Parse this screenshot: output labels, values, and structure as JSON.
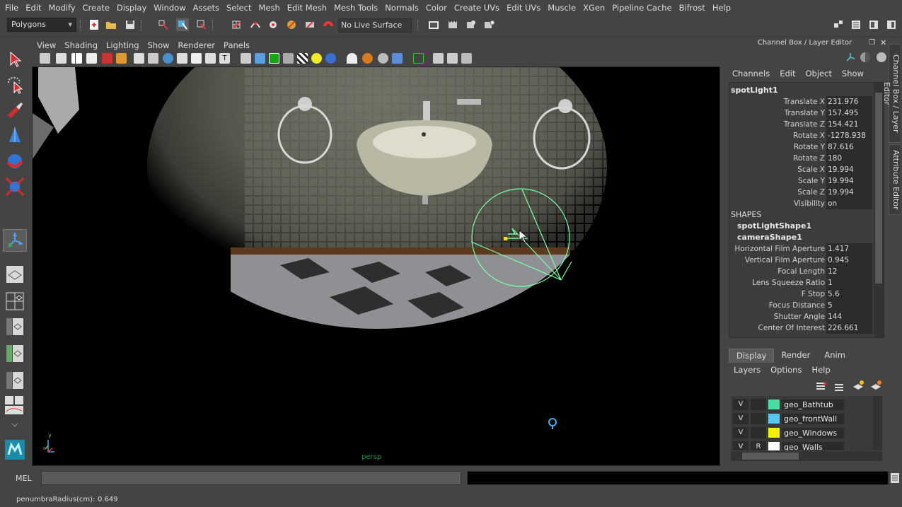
{
  "menubar": [
    "File",
    "Edit",
    "Modify",
    "Create",
    "Display",
    "Window",
    "Assets",
    "Select",
    "Mesh",
    "Edit Mesh",
    "Mesh Tools",
    "Normals",
    "Color",
    "Create UVs",
    "Edit UVs",
    "Muscle",
    "XGen",
    "Pipeline Cache",
    "Bifrost",
    "Help"
  ],
  "toolbar": {
    "mode": "Polygons",
    "live_surface": "No Live Surface"
  },
  "viewport": {
    "menu": [
      "View",
      "Shading",
      "Lighting",
      "Show",
      "Renderer",
      "Panels"
    ],
    "camera_label": "persp",
    "axis_x": "x",
    "axis_y": "y"
  },
  "channel_box": {
    "header": "Channel Box / Layer Editor",
    "menu": [
      "Channels",
      "Edit",
      "Object",
      "Show"
    ],
    "object": "spotLight1",
    "attributes": [
      {
        "label": "Translate X",
        "value": "231.976"
      },
      {
        "label": "Translate Y",
        "value": "157.495"
      },
      {
        "label": "Translate Z",
        "value": "154.421"
      },
      {
        "label": "Rotate X",
        "value": "-1278.938"
      },
      {
        "label": "Rotate Y",
        "value": "87.616"
      },
      {
        "label": "Rotate Z",
        "value": "180"
      },
      {
        "label": "Scale X",
        "value": "19.994"
      },
      {
        "label": "Scale Y",
        "value": "19.994"
      },
      {
        "label": "Scale Z",
        "value": "19.994"
      },
      {
        "label": "Visibility",
        "value": "on"
      }
    ],
    "shapes_label": "SHAPES",
    "shape1": "spotLightShape1",
    "shape2": "cameraShape1",
    "shape_attributes": [
      {
        "label": "Horizontal Film Aperture",
        "value": "1.417"
      },
      {
        "label": "Vertical Film Aperture",
        "value": "0.945"
      },
      {
        "label": "Focal Length",
        "value": "12"
      },
      {
        "label": "Lens Squeeze Ratio",
        "value": "1"
      },
      {
        "label": "F Stop",
        "value": "5.6"
      },
      {
        "label": "Focus Distance",
        "value": "5"
      },
      {
        "label": "Shutter Angle",
        "value": "144"
      },
      {
        "label": "Center Of Interest",
        "value": "226.661"
      }
    ]
  },
  "side_tabs": {
    "channel_box": "Channel Box / Layer Editor",
    "attribute_editor": "Attribute Editor"
  },
  "layer_editor": {
    "tabs": [
      "Display",
      "Render",
      "Anim"
    ],
    "menu": [
      "Layers",
      "Options",
      "Help"
    ],
    "layers": [
      {
        "v": "V",
        "r": "",
        "name": "geo_Bathtub",
        "color": "#44e0a0"
      },
      {
        "v": "V",
        "r": "",
        "name": "geo_frontWall",
        "color": "#55c8f0"
      },
      {
        "v": "V",
        "r": "",
        "name": "geo_Windows",
        "color": "#f2f200"
      },
      {
        "v": "V",
        "r": "R",
        "name": "geo_Walls",
        "color": "#ffffff"
      }
    ]
  },
  "cmdline": {
    "label": "MEL"
  },
  "helpline": {
    "label": "penumbraRadius(cm):",
    "value": "0.649"
  },
  "colors": {
    "accent_green": "#7cffa8",
    "layer_active": "#5a5a5a"
  }
}
